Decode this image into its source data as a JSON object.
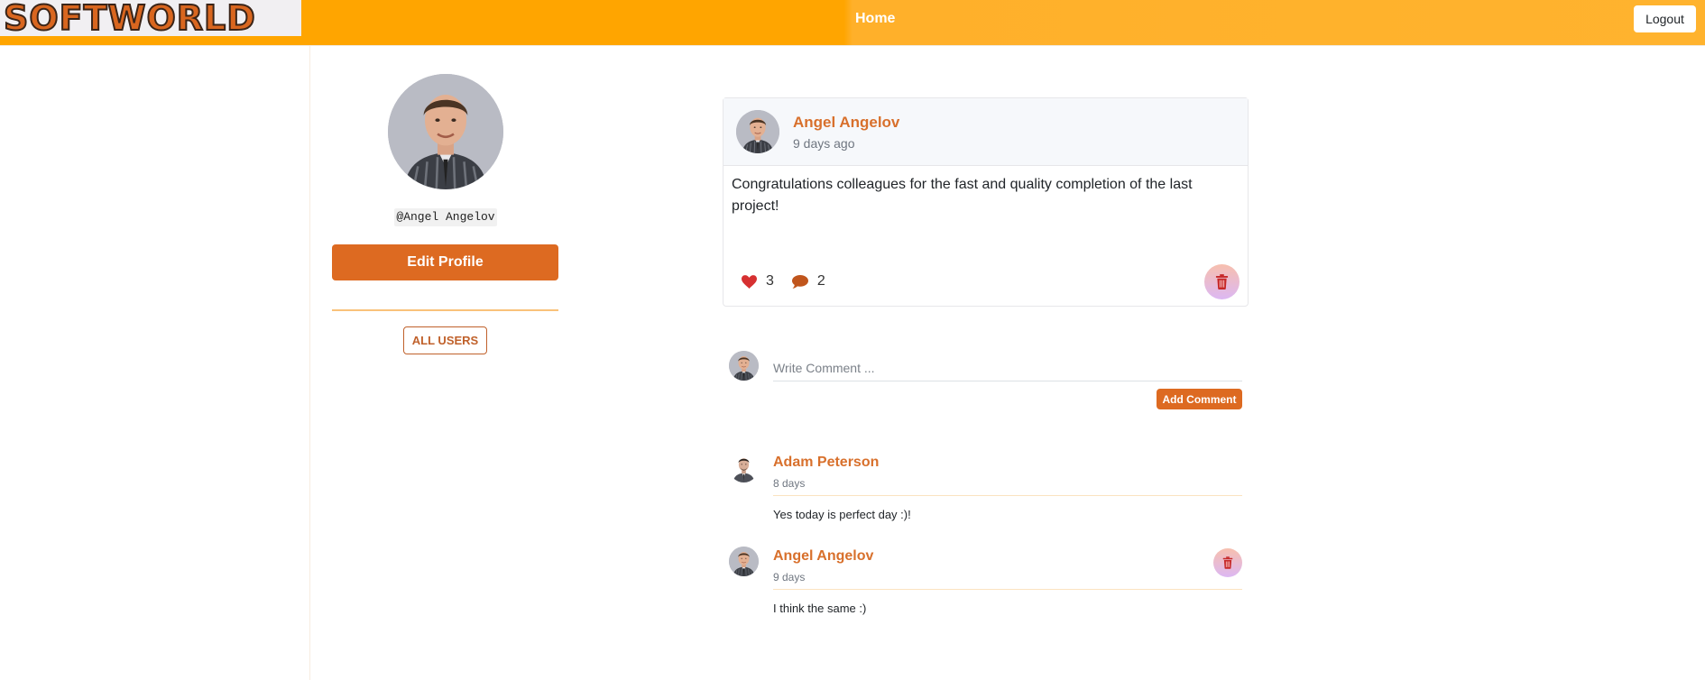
{
  "navbar": {
    "logo_text": "SOFTWORLD",
    "home_label": "Home",
    "logout_label": "Logout",
    "accent_color": "#ffa500"
  },
  "profile": {
    "username": "@Angel Angelov",
    "edit_profile_label": "Edit Profile",
    "all_users_label": "ALL USERS",
    "avatar_icon": "user-photo"
  },
  "post": {
    "author": "Angel Angelov",
    "time": "9 days ago",
    "body": "Congratulations colleagues for the fast and quality completion of the last project!",
    "likes": "3",
    "comments_count": "2",
    "like_icon": "heart-icon",
    "comment_icon": "speech-bubble-icon",
    "delete_icon": "trash-icon"
  },
  "comment_form": {
    "placeholder": "Write Comment ...",
    "submit_label": "Add Comment"
  },
  "comments": [
    {
      "author": "Adam Peterson",
      "time": "8 days",
      "text": "Yes today is perfect day :)!",
      "deletable": false
    },
    {
      "author": "Angel Angelov",
      "time": "9 days",
      "text": "I think the same :)",
      "deletable": true
    }
  ],
  "colors": {
    "brand_orange": "#dd6a21",
    "link_orange": "#d8702c",
    "heart_red": "#d63031"
  }
}
